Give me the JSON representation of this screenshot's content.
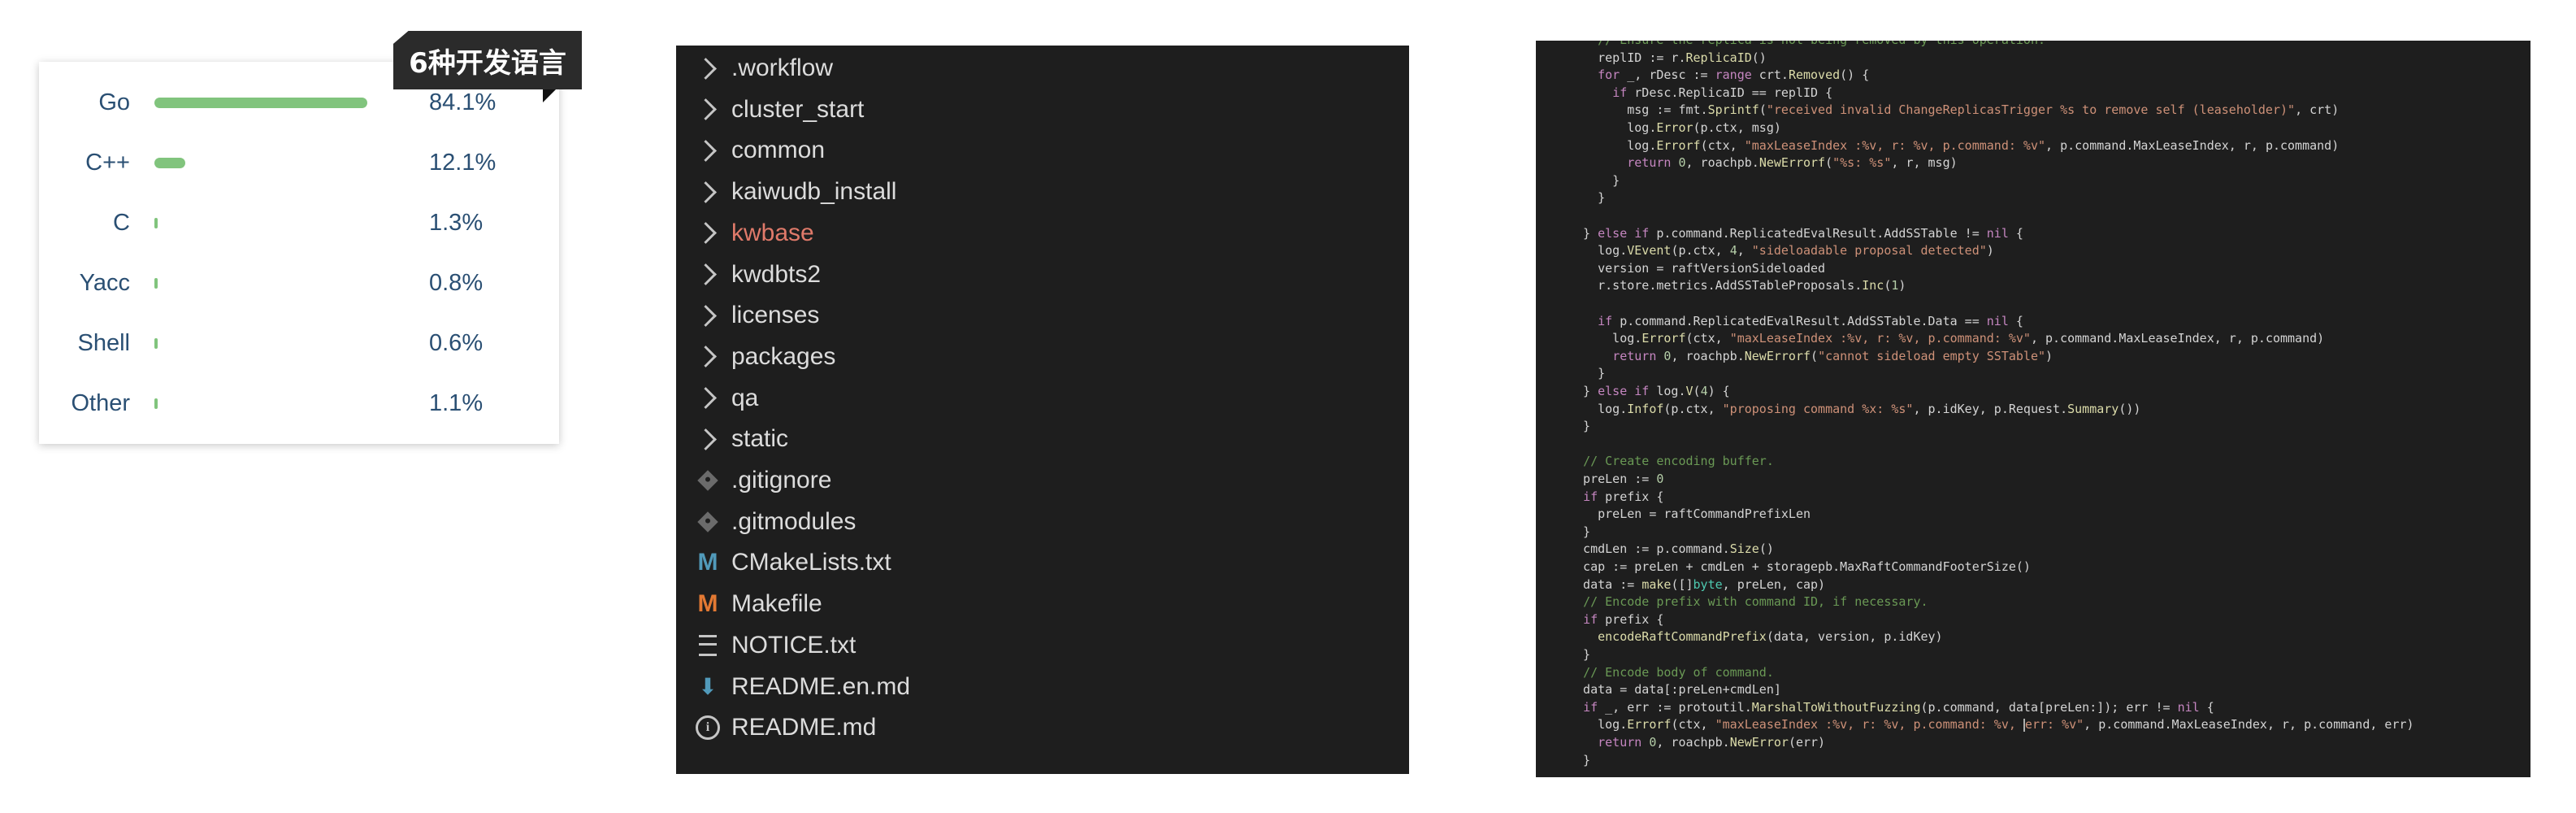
{
  "language_card": {
    "badge": "6种开发语言",
    "rows": [
      {
        "name": "Go",
        "percent": "84.1%",
        "share": 0.841
      },
      {
        "name": "C++",
        "percent": "12.1%",
        "share": 0.121
      },
      {
        "name": "C",
        "percent": "1.3%",
        "share": 0.013
      },
      {
        "name": "Yacc",
        "percent": "0.8%",
        "share": 0.008
      },
      {
        "name": "Shell",
        "percent": "0.6%",
        "share": 0.006
      },
      {
        "name": "Other",
        "percent": "1.1%",
        "share": 0.011
      }
    ],
    "bar_color": "#81c47d"
  },
  "explorer": {
    "items": [
      {
        "label": ".workflow",
        "icon": "chevron-right-icon"
      },
      {
        "label": "cluster_start",
        "icon": "chevron-right-icon"
      },
      {
        "label": "common",
        "icon": "chevron-right-icon"
      },
      {
        "label": "kaiwudb_install",
        "icon": "chevron-right-icon"
      },
      {
        "label": "kwbase",
        "icon": "chevron-right-icon",
        "modified": true
      },
      {
        "label": "kwdbts2",
        "icon": "chevron-right-icon"
      },
      {
        "label": "licenses",
        "icon": "chevron-right-icon"
      },
      {
        "label": "packages",
        "icon": "chevron-right-icon"
      },
      {
        "label": "qa",
        "icon": "chevron-right-icon"
      },
      {
        "label": "static",
        "icon": "chevron-right-icon"
      },
      {
        "label": ".gitignore",
        "icon": "git-icon"
      },
      {
        "label": ".gitmodules",
        "icon": "git-icon"
      },
      {
        "label": "CMakeLists.txt",
        "icon": "cmake-icon"
      },
      {
        "label": "Makefile",
        "icon": "makefile-icon"
      },
      {
        "label": "NOTICE.txt",
        "icon": "text-file-icon"
      },
      {
        "label": "README.en.md",
        "icon": "markdown-download-icon"
      },
      {
        "label": "README.md",
        "icon": "info-icon"
      }
    ],
    "modified_color": "#e07a6a"
  },
  "editor": {
    "lines": [
      [
        [
          "    ",
          ""
        ],
        [
          "// Ensure the replica is not being removed by this operation.",
          "com"
        ]
      ],
      [
        [
          "    replID := r.",
          ""
        ],
        [
          "ReplicaID",
          "fn"
        ],
        [
          "()",
          ""
        ]
      ],
      [
        [
          "    ",
          ""
        ],
        [
          "for",
          "kw"
        ],
        [
          " _, rDesc := ",
          ""
        ],
        [
          "range",
          "kw"
        ],
        [
          " crt.",
          ""
        ],
        [
          "Removed",
          "fn"
        ],
        [
          "() {",
          ""
        ]
      ],
      [
        [
          "      ",
          ""
        ],
        [
          "if",
          "kw"
        ],
        [
          " rDesc.ReplicaID == replID {",
          ""
        ]
      ],
      [
        [
          "        msg := fmt.",
          ""
        ],
        [
          "Sprintf",
          "fn"
        ],
        [
          "(",
          ""
        ],
        [
          "\"received invalid ChangeReplicasTrigger %s to remove self (leaseholder)\"",
          "str"
        ],
        [
          ", crt)",
          ""
        ]
      ],
      [
        [
          "        log.",
          ""
        ],
        [
          "Error",
          "fn"
        ],
        [
          "(p.ctx, msg)",
          ""
        ]
      ],
      [
        [
          "        log.",
          ""
        ],
        [
          "Errorf",
          "fn"
        ],
        [
          "(ctx, ",
          ""
        ],
        [
          "\"maxLeaseIndex :%v, r: %v, p.command: %v\"",
          "str"
        ],
        [
          ", p.command.MaxLeaseIndex, r, p.command)",
          ""
        ]
      ],
      [
        [
          "        ",
          ""
        ],
        [
          "return",
          "kw"
        ],
        [
          " ",
          ""
        ],
        [
          "0",
          "num"
        ],
        [
          ", roachpb.",
          ""
        ],
        [
          "NewErrorf",
          "fn"
        ],
        [
          "(",
          ""
        ],
        [
          "\"%s: %s\"",
          "str"
        ],
        [
          ", r, msg)",
          ""
        ]
      ],
      [
        [
          "      }",
          ""
        ]
      ],
      [
        [
          "    }",
          ""
        ]
      ],
      [
        [
          "",
          ""
        ]
      ],
      [
        [
          "  } ",
          ""
        ],
        [
          "else if",
          "kw"
        ],
        [
          " p.command.ReplicatedEvalResult.AddSSTable != ",
          ""
        ],
        [
          "nil",
          "kw"
        ],
        [
          " {",
          ""
        ]
      ],
      [
        [
          "    log.",
          ""
        ],
        [
          "VEvent",
          "fn"
        ],
        [
          "(p.ctx, ",
          ""
        ],
        [
          "4",
          "num"
        ],
        [
          ", ",
          ""
        ],
        [
          "\"sideloadable proposal detected\"",
          "str"
        ],
        [
          ")",
          ""
        ]
      ],
      [
        [
          "    version = raftVersionSideloaded",
          ""
        ]
      ],
      [
        [
          "    r.store.metrics.AddSSTableProposals.",
          ""
        ],
        [
          "Inc",
          "fn"
        ],
        [
          "(",
          ""
        ],
        [
          "1",
          "num"
        ],
        [
          ")",
          ""
        ]
      ],
      [
        [
          "",
          ""
        ]
      ],
      [
        [
          "    ",
          ""
        ],
        [
          "if",
          "kw"
        ],
        [
          " p.command.ReplicatedEvalResult.AddSSTable.Data == ",
          ""
        ],
        [
          "nil",
          "kw"
        ],
        [
          " {",
          ""
        ]
      ],
      [
        [
          "      log.",
          ""
        ],
        [
          "Errorf",
          "fn"
        ],
        [
          "(ctx, ",
          ""
        ],
        [
          "\"maxLeaseIndex :%v, r: %v, p.command: %v\"",
          "str"
        ],
        [
          ", p.command.MaxLeaseIndex, r, p.command)",
          ""
        ]
      ],
      [
        [
          "      ",
          ""
        ],
        [
          "return",
          "kw"
        ],
        [
          " ",
          ""
        ],
        [
          "0",
          "num"
        ],
        [
          ", roachpb.",
          ""
        ],
        [
          "NewErrorf",
          "fn"
        ],
        [
          "(",
          ""
        ],
        [
          "\"cannot sideload empty SSTable\"",
          "str"
        ],
        [
          ")",
          ""
        ]
      ],
      [
        [
          "    }",
          ""
        ]
      ],
      [
        [
          "  } ",
          ""
        ],
        [
          "else if",
          "kw"
        ],
        [
          " log.",
          ""
        ],
        [
          "V",
          "fn"
        ],
        [
          "(",
          ""
        ],
        [
          "4",
          "num"
        ],
        [
          ") {",
          ""
        ]
      ],
      [
        [
          "    log.",
          ""
        ],
        [
          "Infof",
          "fn"
        ],
        [
          "(p.ctx, ",
          ""
        ],
        [
          "\"proposing command %x: %s\"",
          "str"
        ],
        [
          ", p.idKey, p.Request.",
          ""
        ],
        [
          "Summary",
          "fn"
        ],
        [
          "())",
          ""
        ]
      ],
      [
        [
          "  }",
          ""
        ]
      ],
      [
        [
          "",
          ""
        ]
      ],
      [
        [
          "  ",
          ""
        ],
        [
          "// Create encoding buffer.",
          "com"
        ]
      ],
      [
        [
          "  preLen := ",
          ""
        ],
        [
          "0",
          "num"
        ]
      ],
      [
        [
          "  ",
          ""
        ],
        [
          "if",
          "kw"
        ],
        [
          " prefix {",
          ""
        ]
      ],
      [
        [
          "    preLen = raftCommandPrefixLen",
          ""
        ]
      ],
      [
        [
          "  }",
          ""
        ]
      ],
      [
        [
          "  cmdLen := p.command.",
          ""
        ],
        [
          "Size",
          "fn"
        ],
        [
          "()",
          ""
        ]
      ],
      [
        [
          "  cap := preLen + cmdLen + storagepb.MaxRaftCommandFooterSize",
          ""
        ],
        [
          "()",
          ""
        ]
      ],
      [
        [
          "  data := ",
          ""
        ],
        [
          "make",
          "fn"
        ],
        [
          "([]",
          ""
        ],
        [
          "byte",
          "type"
        ],
        [
          ", preLen, cap)",
          ""
        ]
      ],
      [
        [
          "  ",
          ""
        ],
        [
          "// Encode prefix with command ID, if necessary.",
          "com"
        ]
      ],
      [
        [
          "  ",
          ""
        ],
        [
          "if",
          "kw"
        ],
        [
          " prefix {",
          ""
        ]
      ],
      [
        [
          "    ",
          ""
        ],
        [
          "encodeRaftCommandPrefix",
          "fn"
        ],
        [
          "(data, version, p.idKey)",
          ""
        ]
      ],
      [
        [
          "  }",
          ""
        ]
      ],
      [
        [
          "  ",
          ""
        ],
        [
          "// Encode body of command.",
          "com"
        ]
      ],
      [
        [
          "  data = data[:preLen+cmdLen]",
          ""
        ]
      ],
      [
        [
          "  ",
          ""
        ],
        [
          "if",
          "kw"
        ],
        [
          " _, err := protoutil.",
          ""
        ],
        [
          "MarshalToWithoutFuzzing",
          "fn"
        ],
        [
          "(p.command, data[preLen:]); err != ",
          ""
        ],
        [
          "nil",
          "kw"
        ],
        [
          " {",
          ""
        ]
      ],
      [
        [
          "    log.",
          ""
        ],
        [
          "Errorf",
          "fn"
        ],
        [
          "(ctx, ",
          ""
        ],
        [
          "\"maxLeaseIndex :%v, r: %v, p.command: %v, ",
          "str"
        ],
        [
          "CURSOR",
          "cursor"
        ],
        [
          "err: %v\"",
          "str"
        ],
        [
          ", p.command.MaxLeaseIndex, r, p.command, err)",
          ""
        ]
      ],
      [
        [
          "    ",
          ""
        ],
        [
          "return",
          "kw"
        ],
        [
          " ",
          ""
        ],
        [
          "0",
          "num"
        ],
        [
          ", roachpb.",
          ""
        ],
        [
          "NewError",
          "fn"
        ],
        [
          "(err)",
          ""
        ]
      ],
      [
        [
          "  }",
          ""
        ]
      ]
    ]
  }
}
